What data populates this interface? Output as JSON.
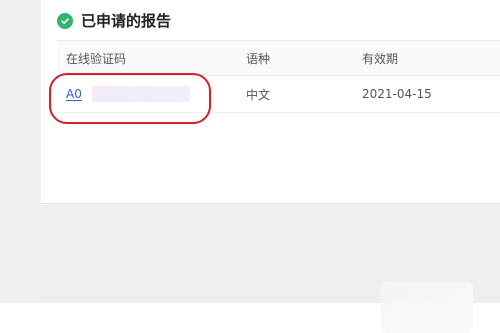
{
  "section": {
    "title": "已申请的报告"
  },
  "table": {
    "headers": [
      "在线验证码",
      "语种",
      "有效期"
    ],
    "rows": [
      {
        "code": "A0",
        "language": "中文",
        "valid_until": "2021-04-15"
      }
    ]
  },
  "icons": {
    "section_status": "check-circle-icon"
  },
  "colors": {
    "success": "#33b46a",
    "link": "#2f62d1",
    "annotation": "#d61f2a"
  }
}
